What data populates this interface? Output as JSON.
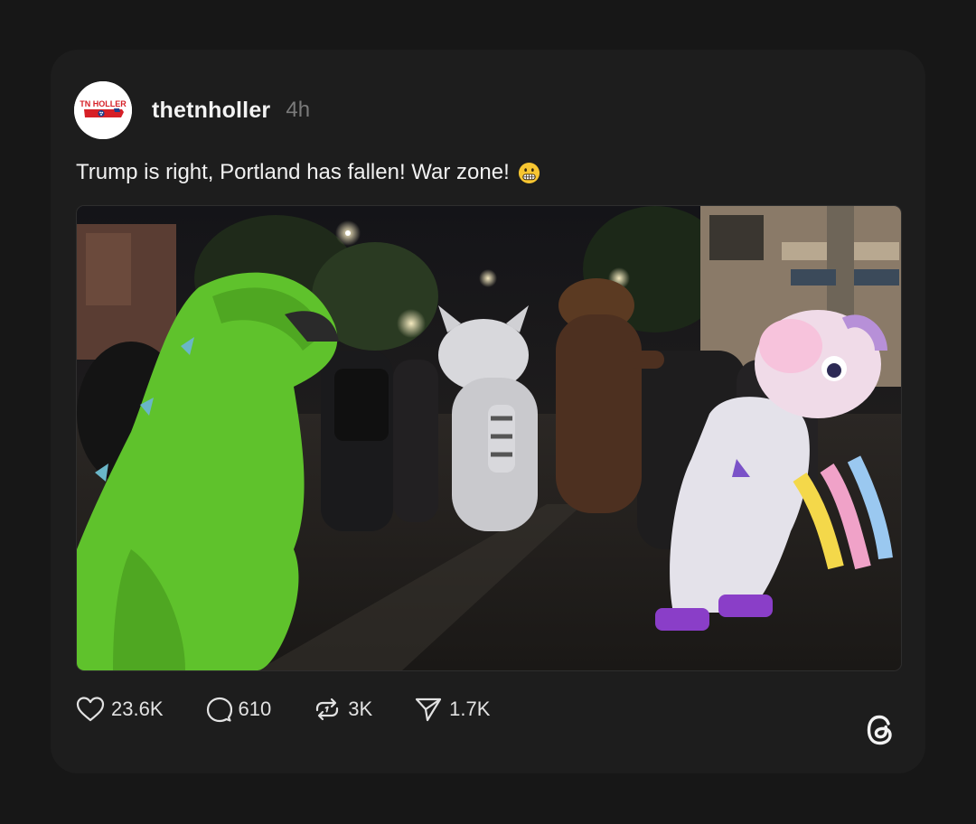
{
  "post": {
    "avatar_text": "TN HOLLER",
    "avatar_icon": "tn-holler-logo",
    "username": "thetnholler",
    "timestamp": "4h",
    "text": "Trump is right, Portland has fallen! War zone!",
    "emoji": "grimacing-face",
    "media_description_icon": "video-thumbnail"
  },
  "actions": {
    "likes": "23.6K",
    "replies": "610",
    "reposts": "3K",
    "shares": "1.7K"
  },
  "brand": {
    "logo_icon": "threads-logo-icon"
  },
  "colors": {
    "background": "#171717",
    "card": "#1d1d1d",
    "text": "#f1f1f1",
    "muted": "#7a7a7a",
    "brand_red": "#d61f26",
    "brand_blue": "#1f3f8c"
  }
}
